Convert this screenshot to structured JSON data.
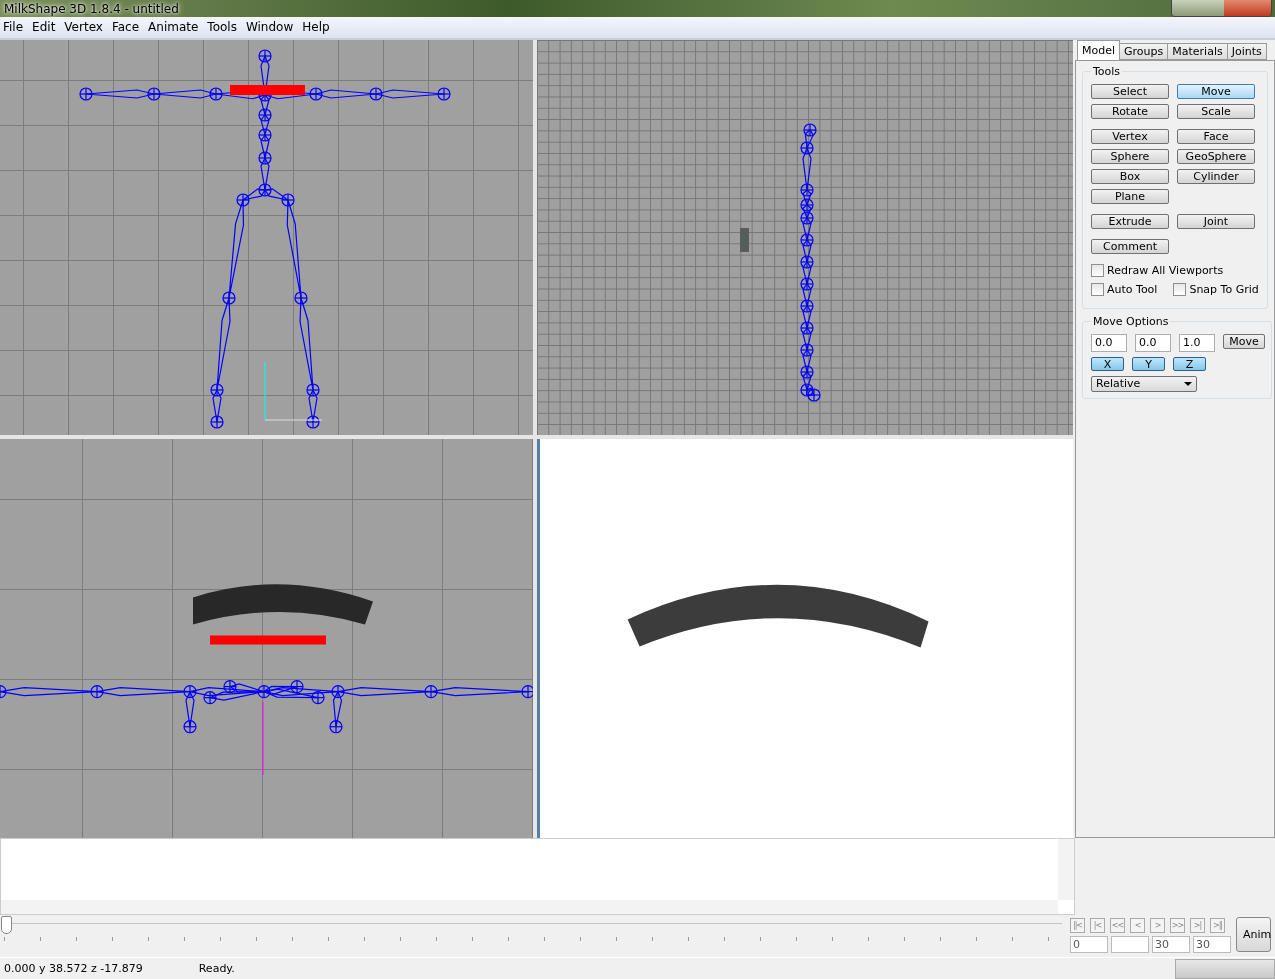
{
  "window": {
    "title": "MilkShape 3D 1.8.4 - untitled"
  },
  "menu": [
    "File",
    "Edit",
    "Vertex",
    "Face",
    "Animate",
    "Tools",
    "Window",
    "Help"
  ],
  "viewports": [
    {
      "kind": "front"
    },
    {
      "kind": "side"
    },
    {
      "kind": "top"
    },
    {
      "kind": "render"
    }
  ],
  "tabs": [
    {
      "label": "Model",
      "selected": true
    },
    {
      "label": "Groups",
      "selected": false
    },
    {
      "label": "Materials",
      "selected": false
    },
    {
      "label": "Joints",
      "selected": false
    }
  ],
  "tools": {
    "title": "Tools",
    "button_groups": [
      [
        [
          {
            "label": "Select",
            "selected": false
          },
          {
            "label": "Move",
            "selected": true
          }
        ],
        [
          {
            "label": "Rotate",
            "selected": false
          },
          {
            "label": "Scale",
            "selected": false
          }
        ]
      ],
      [
        [
          {
            "label": "Vertex",
            "selected": false
          },
          {
            "label": "Face",
            "selected": false
          }
        ],
        [
          {
            "label": "Sphere",
            "selected": false
          },
          {
            "label": "GeoSphere",
            "selected": false
          }
        ],
        [
          {
            "label": "Box",
            "selected": false
          },
          {
            "label": "Cylinder",
            "selected": false
          }
        ],
        [
          {
            "label": "Plane",
            "selected": false
          }
        ]
      ],
      [
        [
          {
            "label": "Extrude",
            "selected": false
          },
          {
            "label": "Joint",
            "selected": false
          }
        ]
      ],
      [
        [
          {
            "label": "Comment",
            "selected": false
          }
        ]
      ]
    ],
    "checkbox_rows": [
      [
        {
          "label": "Redraw All Viewports",
          "checked": false
        }
      ],
      [
        {
          "label": "Auto Tool",
          "checked": false
        },
        {
          "label": "Snap To Grid",
          "checked": false
        }
      ]
    ]
  },
  "move_options": {
    "title": "Move Options",
    "fields": [
      "0.0",
      "0.0",
      "1.0"
    ],
    "button": "Move",
    "axes": [
      {
        "label": "X",
        "selected": true
      },
      {
        "label": "Y",
        "selected": true
      },
      {
        "label": "Z",
        "selected": true
      }
    ],
    "mode": "Relative"
  },
  "timeline": {
    "level": 0,
    "buttons": [
      "||<",
      "|<",
      "<<",
      "<",
      ">",
      ">>",
      ">|",
      ">||"
    ],
    "frame_fields": [
      {
        "kind": "value",
        "value": "0"
      },
      {
        "kind": "blank"
      },
      {
        "kind": "value",
        "value": "30"
      },
      {
        "kind": "value",
        "value": "30"
      }
    ],
    "anim_button": "Anim"
  },
  "status_bar": {
    "coordinates": "0.000 y 38.572 z -17.879",
    "message": "Ready."
  }
}
